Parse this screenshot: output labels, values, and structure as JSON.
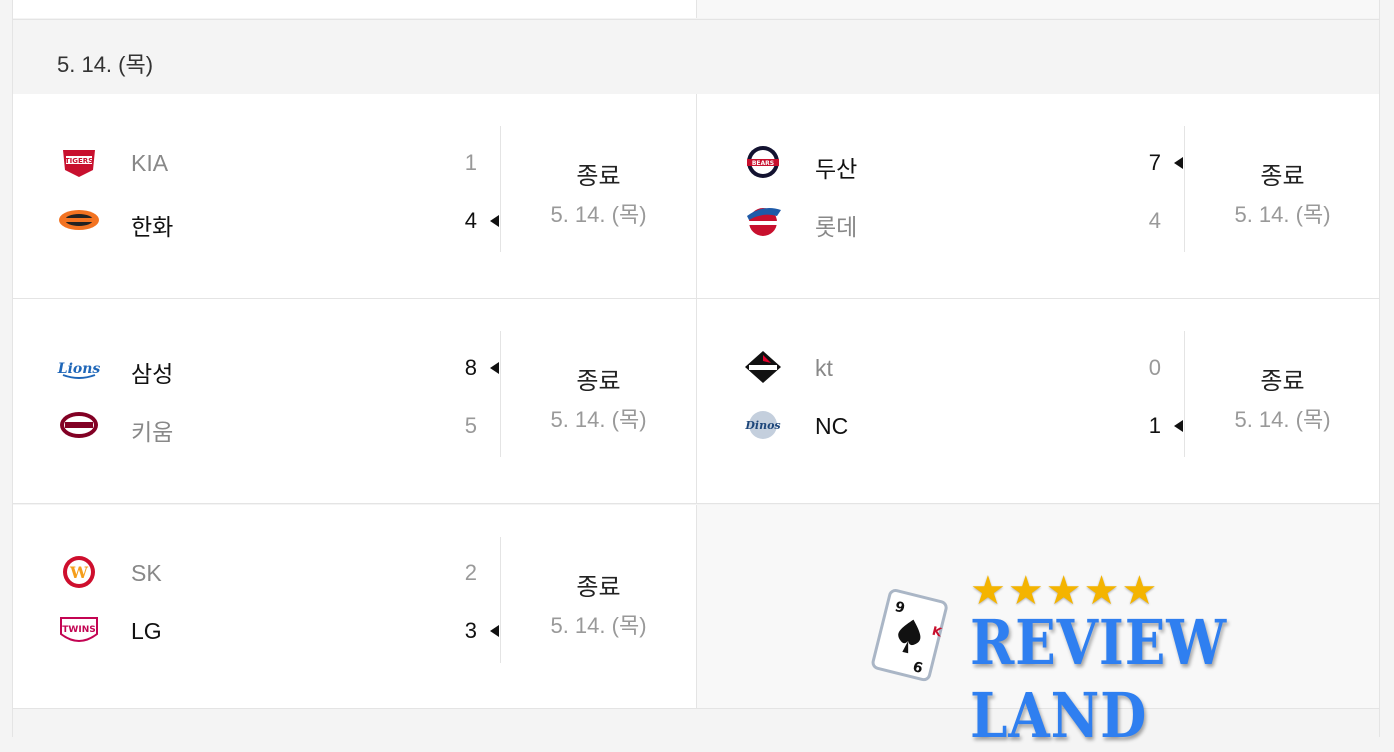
{
  "date_header": "5. 14. (목)",
  "games": [
    {
      "home": {
        "name": "KIA",
        "score": "1",
        "winner": false,
        "logo": "tigers-logo"
      },
      "away": {
        "name": "한화",
        "score": "4",
        "winner": true,
        "logo": "eagles-logo"
      },
      "status": "종료",
      "date": "5. 14. (목)"
    },
    {
      "home": {
        "name": "두산",
        "score": "7",
        "winner": true,
        "logo": "bears-logo"
      },
      "away": {
        "name": "롯데",
        "score": "4",
        "winner": false,
        "logo": "giants-logo"
      },
      "status": "종료",
      "date": "5. 14. (목)"
    },
    {
      "home": {
        "name": "삼성",
        "score": "8",
        "winner": true,
        "logo": "lions-logo"
      },
      "away": {
        "name": "키움",
        "score": "5",
        "winner": false,
        "logo": "heroes-logo"
      },
      "status": "종료",
      "date": "5. 14. (목)"
    },
    {
      "home": {
        "name": "kt",
        "score": "0",
        "winner": false,
        "logo": "wiz-logo"
      },
      "away": {
        "name": "NC",
        "score": "1",
        "winner": true,
        "logo": "dinos-logo"
      },
      "status": "종료",
      "date": "5. 14. (목)"
    },
    {
      "home": {
        "name": "SK",
        "score": "2",
        "winner": false,
        "logo": "wyverns-logo"
      },
      "away": {
        "name": "LG",
        "score": "3",
        "winner": true,
        "logo": "twins-logo"
      },
      "status": "종료",
      "date": "5. 14. (목)"
    }
  ],
  "watermark": {
    "stars": "★★★★★",
    "brand": "REVIEW LAND"
  },
  "colors": {
    "win": "#111111",
    "lose": "#888888",
    "brand": "#2f7ff0",
    "star": "#f4b400"
  }
}
